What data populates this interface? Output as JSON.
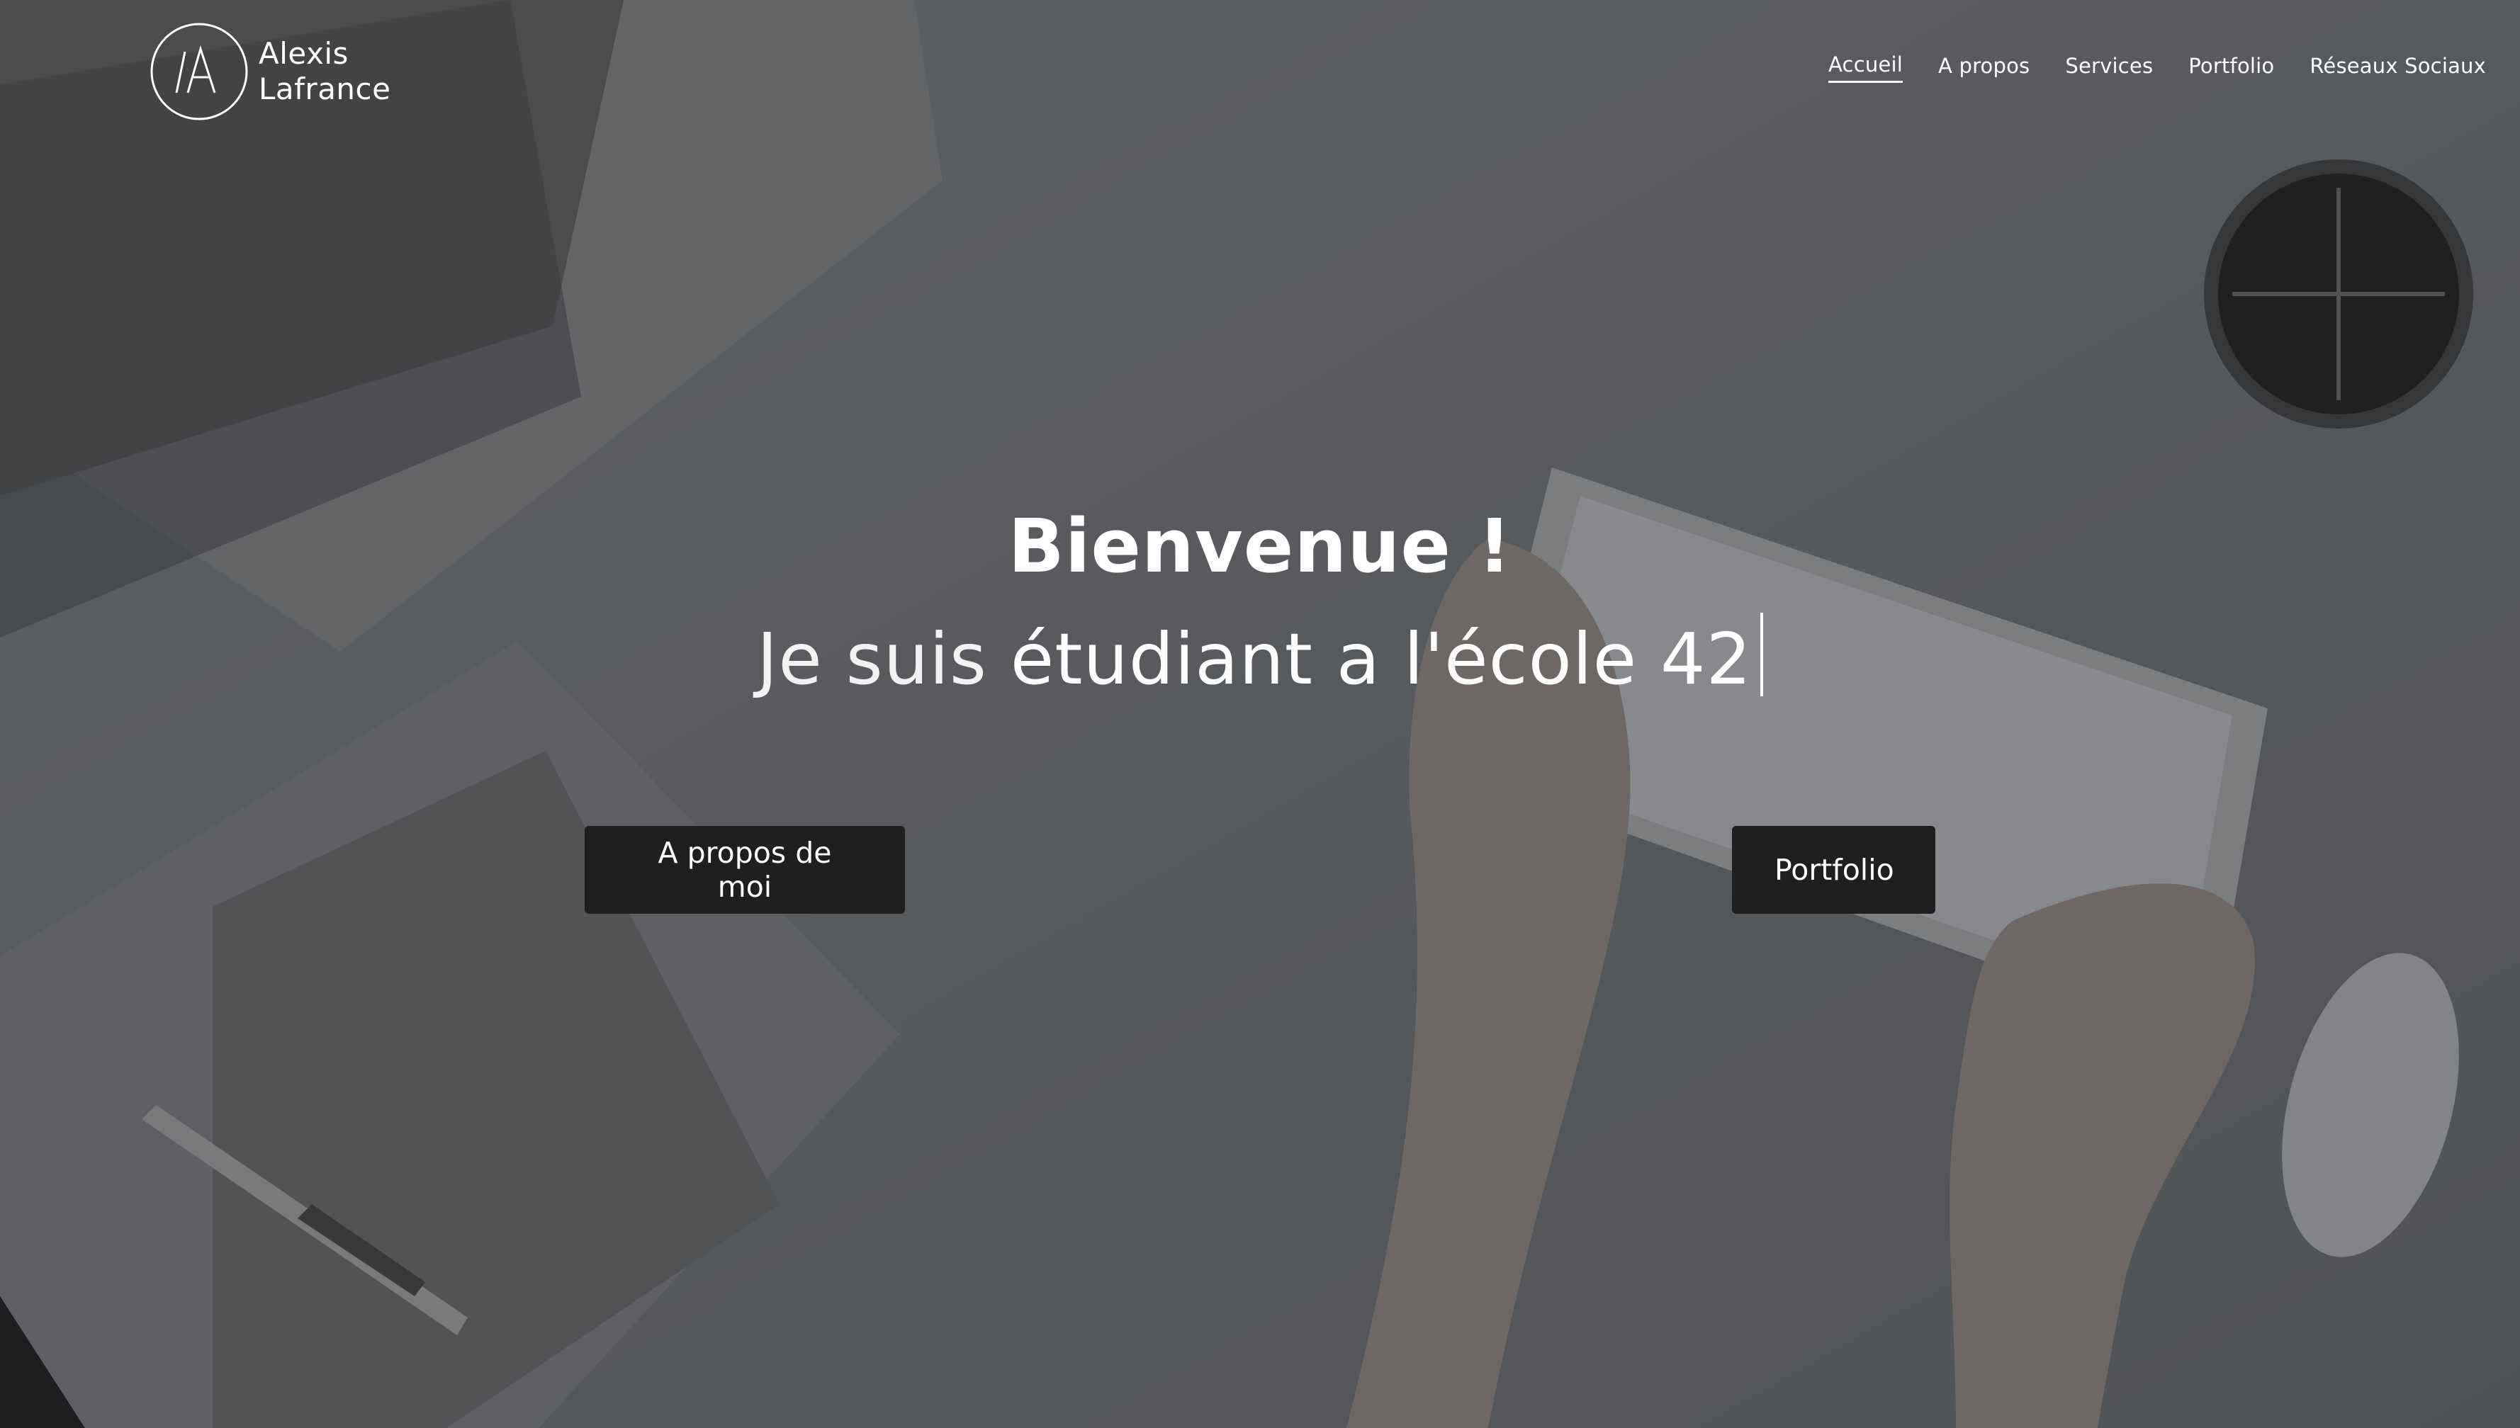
{
  "brand": {
    "first_name": "Alexis",
    "last_name": "Lafrance",
    "monogram": "/A"
  },
  "nav": {
    "items": [
      {
        "label": "Accueil",
        "active": true
      },
      {
        "label": "A propos",
        "active": false
      },
      {
        "label": "Services",
        "active": false
      },
      {
        "label": "Portfolio",
        "active": false
      },
      {
        "label": "Réseaux Sociaux",
        "active": false
      }
    ]
  },
  "hero": {
    "title": "Bienvenue !",
    "subtitle_prefix": "Je suis ",
    "subtitle_typed": "étudiant a l'école 42",
    "buttons": {
      "about": "A propos de moi",
      "portfolio": "Portfolio"
    }
  },
  "colors": {
    "overlay": "#5d5f62",
    "button_bg": "#1f1f1f",
    "text": "#ffffff"
  },
  "icons": [
    "logo-monogram-icon",
    "text-cursor-icon"
  ]
}
